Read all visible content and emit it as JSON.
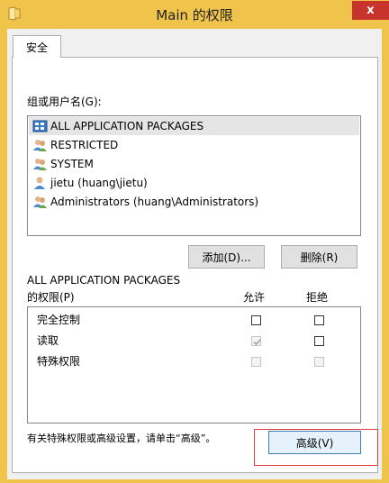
{
  "window": {
    "title": "Main 的权限",
    "close_label": "x",
    "close_color": "#c8342b",
    "title_bar_color": "#f0c44a"
  },
  "tabs": [
    {
      "label": "安全",
      "selected": true
    }
  ],
  "security": {
    "group_label": "组或用户名(G):",
    "users": [
      {
        "name": "ALL APPLICATION PACKAGES",
        "icon": "app-packages-icon",
        "selected": true
      },
      {
        "name": "RESTRICTED",
        "icon": "users-group-icon",
        "selected": false
      },
      {
        "name": "SYSTEM",
        "icon": "users-group-icon",
        "selected": false
      },
      {
        "name": "jietu (huang\\jietu)",
        "icon": "user-icon",
        "selected": false
      },
      {
        "name": "Administrators (huang\\Administrators)",
        "icon": "users-group-icon",
        "selected": false
      }
    ],
    "add_button": "添加(D)...",
    "remove_button": "删除(R)",
    "permissions_for_line1": "ALL APPLICATION PACKAGES",
    "permissions_for_line2": "的权限(P)",
    "allow_header": "允许",
    "deny_header": "拒绝",
    "permissions": [
      {
        "name": "完全控制",
        "allow": false,
        "deny": false,
        "allow_disabled": false,
        "deny_disabled": false
      },
      {
        "name": "读取",
        "allow": true,
        "deny": false,
        "allow_disabled": true,
        "deny_disabled": false
      },
      {
        "name": "特殊权限",
        "allow": false,
        "deny": false,
        "allow_disabled": true,
        "deny_disabled": true
      }
    ],
    "advanced_hint": "有关特殊权限或高级设置，请单击“高级”。",
    "advanced_button": "高级(V)",
    "highlight_color": "#e04040"
  }
}
